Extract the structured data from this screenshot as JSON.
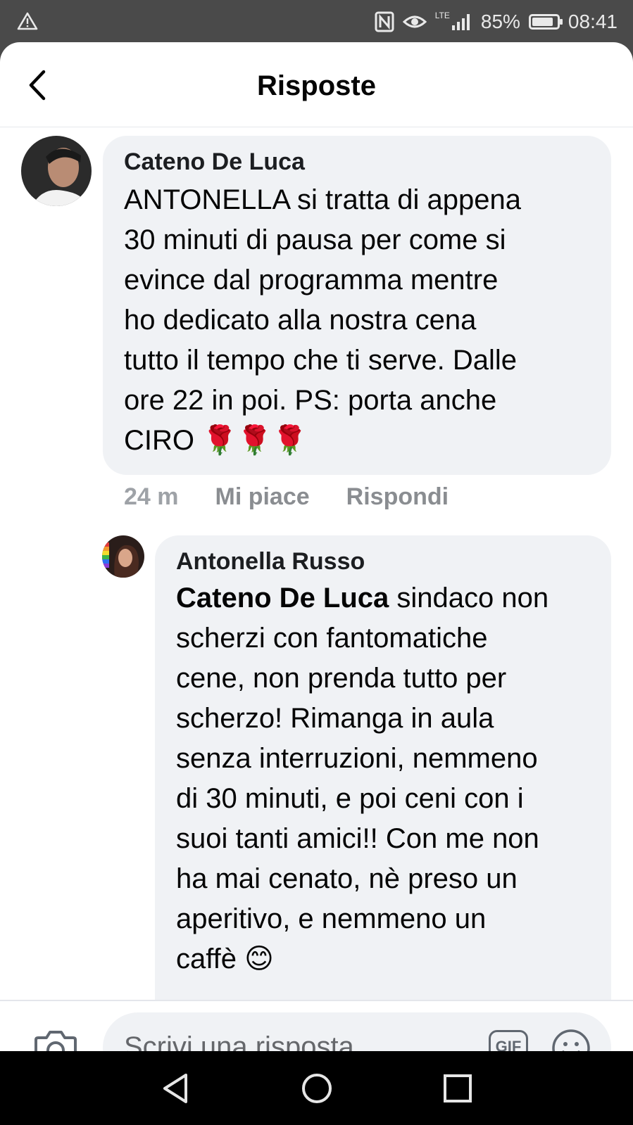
{
  "status_bar": {
    "battery": "85%",
    "time": "08:41",
    "network": "LTE",
    "battery_level": 0.85
  },
  "header": {
    "title": "Risposte"
  },
  "comments": [
    {
      "author": "Cateno De Luca",
      "text_lines": [
        "ANTONELLA si tratta di appena",
        "30 minuti di pausa per come si",
        "evince dal programma mentre",
        "ho dedicato alla nostra cena",
        "tutto il tempo che ti serve. Dalle",
        "ore 22 in poi. PS: porta anche",
        "CIRO 🌹🌹🌹"
      ],
      "time": "24 m",
      "like_label": "Mi piace",
      "reply_label": "Rispondi"
    },
    {
      "author": "Antonella Russo",
      "mention": "Cateno De Luca",
      "first_line_rest": " sindaco non",
      "text_lines": [
        "scherzi con fantomatiche",
        "cene, non prenda tutto per",
        "scherzo! Rimanga in aula",
        "senza interruzioni, nemmeno",
        "di 30 minuti, e poi ceni con i",
        "suoi tanti amici!! Con me non",
        "ha mai cenato, nè preso un",
        "aperitivo, e nemmeno un",
        "caffè 😊"
      ]
    }
  ],
  "composer": {
    "placeholder": "Scrivi una risposta...",
    "gif_label": "GIF"
  },
  "icons": {
    "back": "chevron-left-icon",
    "camera": "camera-icon",
    "emoji": "smiley-icon",
    "warning": "warning-icon",
    "nfc": "nfc-icon",
    "eye": "eye-icon",
    "signal": "signal-icon",
    "battery": "battery-icon",
    "nav_back": "triangle-back-icon",
    "nav_home": "circle-home-icon",
    "nav_recents": "square-recents-icon"
  },
  "colors": {
    "status_bar_bg": "#4a4a4a",
    "bubble_bg": "#f0f2f5",
    "text_primary": "#050505",
    "text_secondary": "#65676b",
    "meta_text": "#8a8d91",
    "nav_bar_bg": "#000000"
  }
}
